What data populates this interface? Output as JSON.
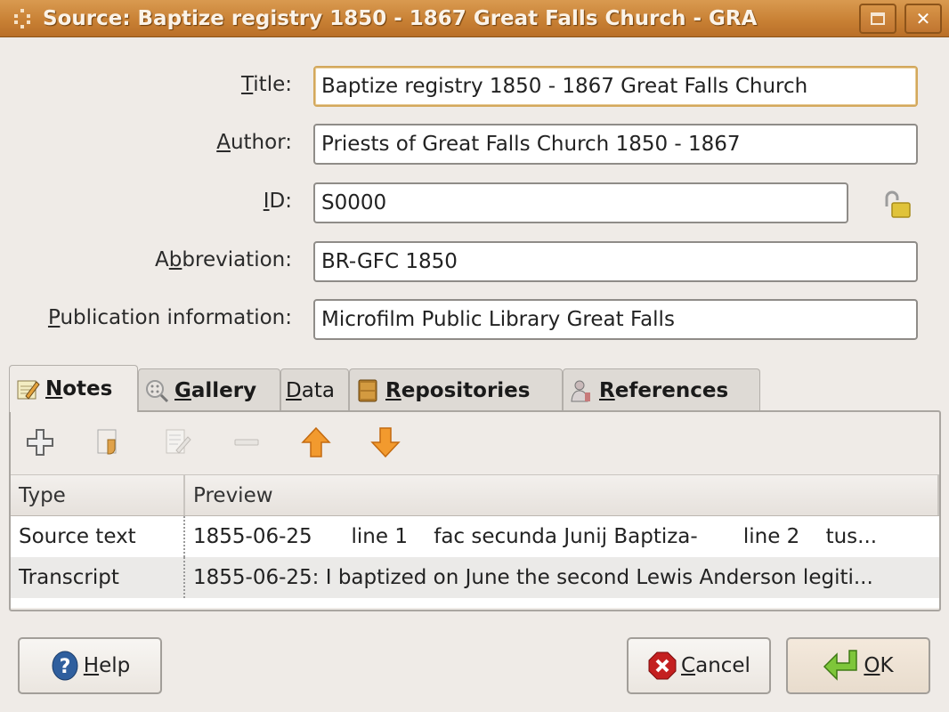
{
  "window": {
    "title": "Source: Baptize registry 1850 - 1867 Great Falls Church - GRA",
    "maximize_icon": "maximize-icon",
    "close_icon": "close-icon"
  },
  "form": {
    "title": {
      "label_ul": "T",
      "label_rest": "itle:",
      "value": "Baptize registry 1850 - 1867 Great Falls Church"
    },
    "author": {
      "label_ul": "A",
      "label_rest": "uthor:",
      "value": "Priests of Great Falls Church 1850 - 1867"
    },
    "id": {
      "label_ul": "I",
      "label_rest": "D:",
      "value": "S0000",
      "lock_icon": "unlocked-padlock-icon"
    },
    "abbreviation": {
      "label_pre": "A",
      "label_ul": "b",
      "label_rest": "breviation:",
      "value": "BR-GFC 1850"
    },
    "publication": {
      "label_ul": "P",
      "label_rest": "ublication information:",
      "value": "Microfilm Public Library Great Falls"
    }
  },
  "tabs": [
    {
      "ul": "N",
      "rest": "otes",
      "icon": "notepad-icon",
      "active": true
    },
    {
      "ul": "G",
      "rest": "allery",
      "icon": "gallery-magnifier-icon"
    },
    {
      "ul": "D",
      "rest": "ata",
      "icon": ""
    },
    {
      "ul": "R",
      "rest": "epositories",
      "icon": "cabinet-icon"
    },
    {
      "ul": "R",
      "rest": "eferences",
      "icon": "person-icon"
    }
  ],
  "toolbar": {
    "add": "add-icon",
    "share": "share-existing-icon",
    "edit": "edit-icon",
    "remove": "remove-icon",
    "up": "move-up-icon",
    "down": "move-down-icon"
  },
  "notes_list": {
    "columns": [
      "Type",
      "Preview"
    ],
    "rows": [
      {
        "type": "Source text",
        "preview": "1855-06-25      line 1    fac secunda Junij Baptiza-       line 2    tus..."
      },
      {
        "type": "Transcript",
        "preview": "1855-06-25: I baptized on June the second Lewis Anderson legiti..."
      }
    ]
  },
  "buttons": {
    "help": {
      "ul": "H",
      "rest": "elp"
    },
    "cancel": {
      "ul": "C",
      "rest": "ancel"
    },
    "ok": {
      "ul": "O",
      "rest": "K"
    }
  }
}
